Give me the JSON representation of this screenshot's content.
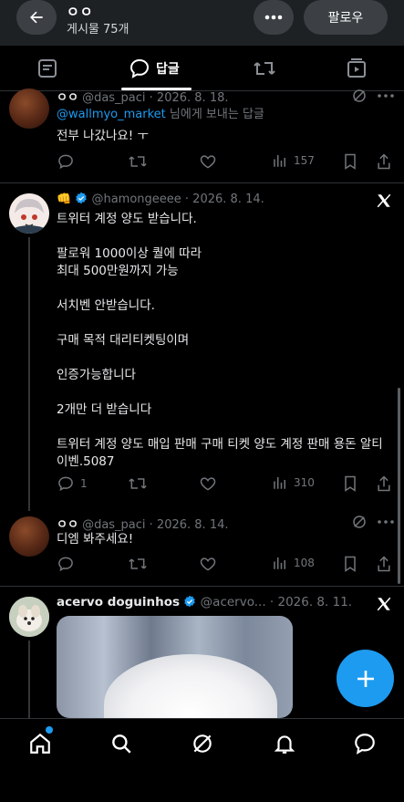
{
  "header": {
    "title": "ㅇㅇ",
    "subtitle": "게시물 75개",
    "follow_label": "팔로우"
  },
  "tabs": [
    {
      "label": ""
    },
    {
      "label": "답글"
    },
    {
      "label": ""
    },
    {
      "label": ""
    }
  ],
  "posts": [
    {
      "name": "ㅇㅇ",
      "handle": "@das_paci",
      "date": "· 2026. 8. 18.",
      "reply_to_mention": "@wallmyo_market",
      "reply_to_suffix": " 님에게 보내는 답글",
      "text_lines": [
        "전부 나갔나요! ㅜ"
      ],
      "reply_count": "",
      "views": "157"
    },
    {
      "name": "👊",
      "handle": "@hamongeeee",
      "date": "· 2026. 8. 14.",
      "text_lines": [
        "트위터 계정 양도 받습니다.",
        "",
        "팔로워 1000이상 퀄에 따라",
        "최대 500만원까지 가능",
        "",
        "서치벤 안받습니다.",
        "",
        "구매 목적 대리티켓팅이며",
        "",
        "인증가능합니다",
        "",
        "2개만 더 받습니다",
        "",
        "트위터 계정 양도 매입 판매 구매 티켓 양도 계정 판매 용돈 알티",
        "이벤.5087"
      ],
      "reply_count": "1",
      "views": "310"
    },
    {
      "name": "ㅇㅇ",
      "handle": "@das_paci",
      "date": "· 2026. 8. 14.",
      "text_lines": [
        "디엠 봐주세요!"
      ],
      "reply_count": "",
      "views": "108"
    },
    {
      "name": "acervo doguinhos",
      "handle": "@acervo...",
      "date": "· 2026. 8. 11."
    }
  ],
  "icons": {
    "verified_color": "#1d9bf0",
    "accent": "#1d9bf0"
  }
}
